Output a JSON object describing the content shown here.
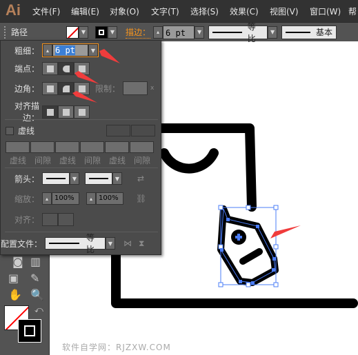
{
  "app": {
    "logo": "Ai"
  },
  "menu": [
    "文件(F)",
    "编辑(E)",
    "对象(O)",
    "文字(T)",
    "选择(S)",
    "效果(C)",
    "视图(V)",
    "窗口(W)",
    "帮"
  ],
  "control": {
    "selection_label": "路径",
    "stroke_label": "描边：",
    "stroke_value": "6 pt",
    "profile_label": "等比",
    "brush_label": "基本"
  },
  "panel": {
    "weight_label": "粗细：",
    "weight_value": "6 pt",
    "cap_label": "端点：",
    "corner_label": "边角：",
    "limit_label": "限制：",
    "limit_value": "",
    "limit_suffix": "x",
    "align_label": "对齐描边：",
    "dashed_label": "虚线",
    "dashed_checked": false,
    "dash_fields": [
      "虚线",
      "间隙",
      "虚线",
      "间隙",
      "虚线",
      "间隙"
    ],
    "arrow_label": "箭头：",
    "scale_label": "缩放：",
    "scale_start": "100%",
    "scale_end": "100%",
    "arrow_align_label": "对齐：",
    "profile_label": "配置文件：",
    "profile_value": "等比"
  },
  "watermark": "软件自学网：RJZXW.COM",
  "colors": {
    "accent": "#f7941d",
    "selection": "#4a7cf7",
    "arrow": "#f03c3c"
  }
}
